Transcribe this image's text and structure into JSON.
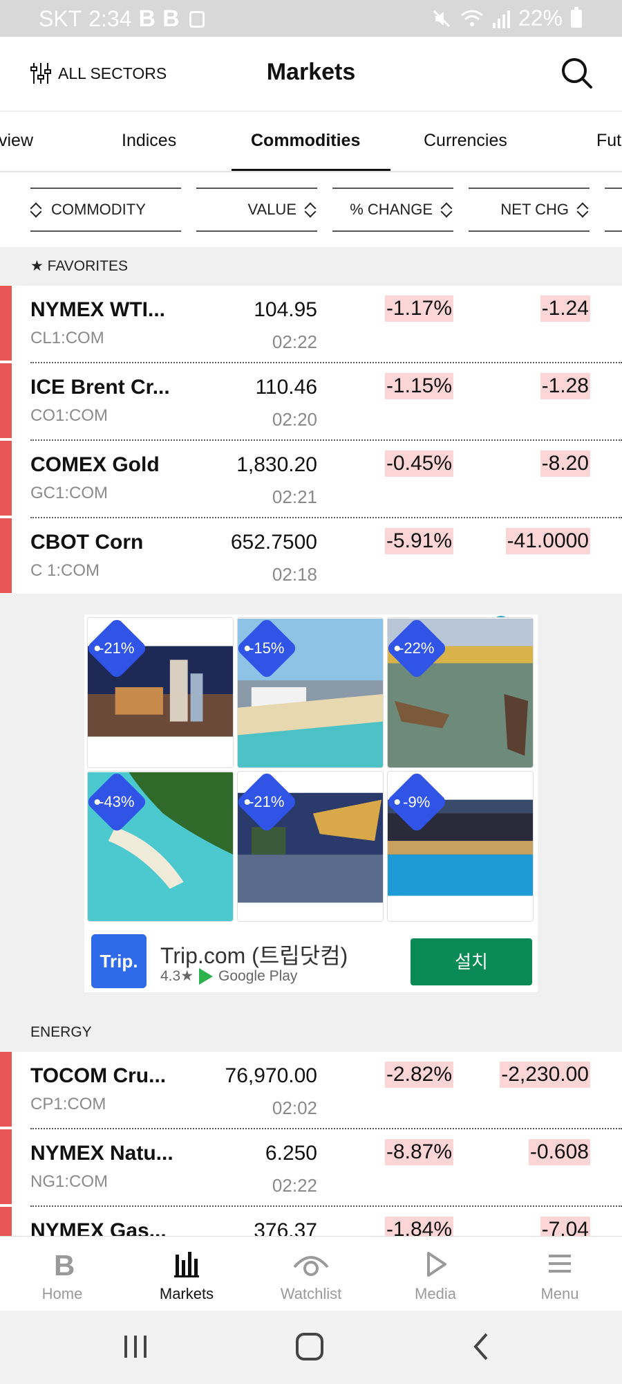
{
  "status_bar": {
    "carrier": "SKT",
    "time": "2:34",
    "app_icons": [
      "B",
      "B"
    ],
    "battery": "22%"
  },
  "header": {
    "sectors_label": "ALL SECTORS",
    "title": "Markets"
  },
  "tabs": [
    "view",
    "Indices",
    "Commodities",
    "Currencies",
    "Fut"
  ],
  "active_tab": "Commodities",
  "columns": {
    "commodity": "COMMODITY",
    "value": "VALUE",
    "pct_change": "% CHANGE",
    "net_chg": "NET CHG"
  },
  "sections": {
    "favorites": "★ FAVORITES",
    "energy": "ENERGY"
  },
  "favorites": [
    {
      "name": "NYMEX WTI...",
      "ticker": "CL1:COM",
      "value": "104.95",
      "time": "02:22",
      "pct": "-1.17%",
      "net": "-1.24"
    },
    {
      "name": "ICE Brent Cr...",
      "ticker": "CO1:COM",
      "value": "110.46",
      "time": "02:20",
      "pct": "-1.15%",
      "net": "-1.28"
    },
    {
      "name": "COMEX Gold",
      "ticker": "GC1:COM",
      "value": "1,830.20",
      "time": "02:21",
      "pct": "-0.45%",
      "net": "-8.20"
    },
    {
      "name": "CBOT Corn",
      "ticker": "C 1:COM",
      "value": "652.7500",
      "time": "02:18",
      "pct": "-5.91%",
      "net": "-41.0000"
    }
  ],
  "energy": [
    {
      "name": "TOCOM Cru...",
      "ticker": "CP1:COM",
      "value": "76,970.00",
      "time": "02:02",
      "pct": "-2.82%",
      "net": "-2,230.00"
    },
    {
      "name": "NYMEX Natu...",
      "ticker": "NG1:COM",
      "value": "6.250",
      "time": "02:22",
      "pct": "-8.87%",
      "net": "-0.608"
    },
    {
      "name": "NYMEX Gas...",
      "ticker": "",
      "value": "376.37",
      "time": "",
      "pct": "-1.84%",
      "net": "-7.04"
    }
  ],
  "ad": {
    "discounts": [
      "-21%",
      "-15%",
      "-22%",
      "-43%",
      "-21%",
      "-9%"
    ],
    "app_logo": "Trip.",
    "app_name": "Trip.com (트립닷컴)",
    "rating": "4.3★",
    "store": "Google Play",
    "install": "설치"
  },
  "bottom_nav": [
    "Home",
    "Markets",
    "Watchlist",
    "Media",
    "Menu"
  ],
  "active_nav": "Markets",
  "colors": {
    "negative_flag": "#e85555",
    "negative_bg": "#fcd6d6",
    "badge": "#2f54e6",
    "install": "#0a8a55"
  }
}
